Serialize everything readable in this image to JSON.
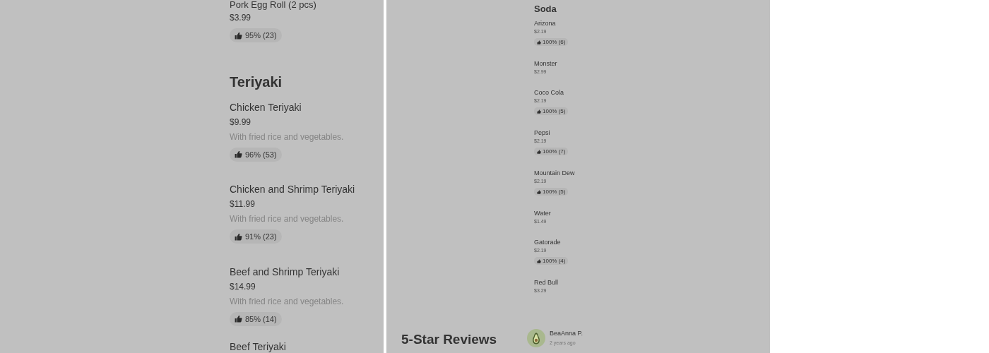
{
  "menu_column": {
    "entries": [
      {
        "kind": "item",
        "name": "Pork Egg Roll (2 pcs)",
        "price": "$3.99",
        "rating": "95% (23)"
      },
      {
        "kind": "heading",
        "title": "Teriyaki"
      },
      {
        "kind": "item",
        "name": "Chicken Teriyaki",
        "price": "$9.99",
        "description": "With fried rice and vegetables.",
        "rating": "96% (53)"
      },
      {
        "kind": "item",
        "name": "Chicken and Shrimp Teriyaki",
        "price": "$11.99",
        "description": "With fried rice and vegetables.",
        "rating": "91% (23)"
      },
      {
        "kind": "item",
        "name": "Beef and Shrimp Teriyaki",
        "price": "$14.99",
        "description": "With fried rice and vegetables.",
        "rating": "85% (14)"
      },
      {
        "kind": "item",
        "name": "Beef Teriyaki"
      }
    ]
  },
  "side_column": {
    "section_title": "Soda",
    "items": [
      {
        "name": "Arizona",
        "price": "$2.19",
        "rating": "100% (6)"
      },
      {
        "name": "Monster",
        "price": "$2.99"
      },
      {
        "name": "Coco Cola",
        "price": "$2.19",
        "rating": "100% (5)"
      },
      {
        "name": "Pepsi",
        "price": "$2.19",
        "rating": "100% (7)"
      },
      {
        "name": "Mountain Dew",
        "price": "$2.19",
        "rating": "100% (5)"
      },
      {
        "name": "Water",
        "price": "$1.49"
      },
      {
        "name": "Gatorade",
        "price": "$2.19",
        "rating": "100% (4)"
      },
      {
        "name": "Red Bull",
        "price": "$3.29"
      }
    ]
  },
  "reviews": {
    "title": "5-Star Reviews",
    "reviews": [
      {
        "author": "BeaAnna P.",
        "time": "2 years ago"
      }
    ]
  }
}
